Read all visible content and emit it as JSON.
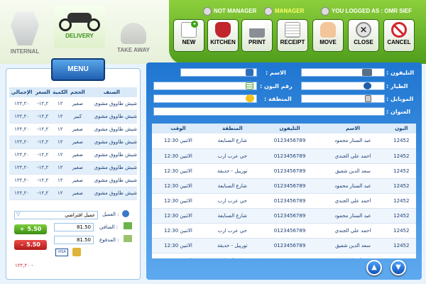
{
  "top": {
    "internal_label": "INTERNAL",
    "delivery_label": "DELIVERY",
    "takeaway_label": "TAKE AWAY",
    "not_manager_label": "NOT MANAGER",
    "manager_label": "MANAGER",
    "logged_in": "YOU LOGGED AS : OMR SIEF"
  },
  "toolbar": {
    "new": "NEW",
    "kitchen": "KITCHEN",
    "print": "PRINT",
    "receipt": "RECEIPT",
    "move": "MOVE",
    "close": "CLOSE",
    "cancel": "CANCEL"
  },
  "menu_label": "MENU",
  "order": {
    "headers": [
      "الصنف",
      "الحجم",
      "الكمية",
      "السعر",
      "الإجمالي"
    ],
    "rows": [
      [
        "شيش طاووق مشوي",
        "صغير",
        "١٢",
        "-١٢,٢",
        "١٢٢,٢٠"
      ],
      [
        "شيش طاووق مشوي",
        "كبير",
        "١٢",
        "-١٢,٢",
        "١٢٢,٢٠"
      ],
      [
        "شيش طاووق مشوي",
        "صغير",
        "١٢",
        "-١٢,٢",
        "١٢٢,٢٠"
      ],
      [
        "شيش طاووق مشوي",
        "صغير",
        "١٢",
        "-١٢,٢",
        "١٢٢,٢٠"
      ],
      [
        "شيش طاووق مشوي",
        "صغير",
        "١٢",
        "-١٢,٢",
        "١٢٢,٢٠"
      ],
      [
        "شيش طاووق مشوي",
        "صغير",
        "١٢",
        "-١٢,٢",
        "١٢٢,٢٠"
      ],
      [
        "شيش طاووق مشوي",
        "صغير",
        "١٢",
        "-١٢,٢",
        "١٢٢,٢٠"
      ],
      [
        "شيش طاووق مشوي",
        "صغير",
        "١٢",
        "-١٢,٢",
        "١٢٢,٢٠"
      ]
    ],
    "total_neg": "١٢٢,٢٠ -"
  },
  "summary": {
    "client_label": ": العميل",
    "client_value": "عميل افتراضي",
    "net_label": ": الصافي",
    "net_value": "81.50",
    "paid_label": ": المدفوع",
    "paid_value": "81.50",
    "plus_value": "5.50",
    "minus_value": "5.50"
  },
  "form": {
    "name_label": "الاسم :",
    "phone_label": "التليفون :",
    "bone_label": "رقم البون :",
    "pilot_label": "الطيار :",
    "area_label": "المنطقة :",
    "mobile_label": "الموبايل :",
    "address_label": "العنوان :"
  },
  "results": {
    "headers": [
      "البون",
      "الاسم",
      "التليفون",
      "المنطقة",
      "الوقت"
    ],
    "rows": [
      [
        "12452",
        "عبد الستار محمود",
        "0123456789",
        "شارع الصنايعة",
        "الاثنين 12:30"
      ],
      [
        "12452",
        "احمد علي الجندي",
        "0123456789",
        "حي عرب ارب",
        "الاثنين 12:30"
      ],
      [
        "12452",
        "سعد الدين شفيق",
        "0123456789",
        "تورييل - حديقة",
        "الاثنين 12:30"
      ],
      [
        "12452",
        "عبد الستار محمود",
        "0123456789",
        "شارع الصنايعة",
        "الاثنين 12:30"
      ],
      [
        "12452",
        "احمد علي الجندي",
        "0123456789",
        "حي عرب ارب",
        "الاثنين 12:30"
      ],
      [
        "12452",
        "عبد الستار محمود",
        "0123456789",
        "شارع الصنايعة",
        "الاثنين 12:30"
      ],
      [
        "12452",
        "احمد علي الجندي",
        "0123456789",
        "حي عرب ارب",
        "الاثنين 12:30"
      ],
      [
        "12452",
        "سعد الدين شفيق",
        "0123456789",
        "تورييل - حديقة",
        "الاثنين 12:30"
      ],
      [
        "12452",
        "عبد الستار محمود",
        "0123456789",
        "شارع الصنايعة",
        "الاثنين 12:30"
      ]
    ]
  },
  "colors": {
    "accent": "#2a7fd6",
    "green": "#5aab23",
    "red": "#d0282e"
  }
}
